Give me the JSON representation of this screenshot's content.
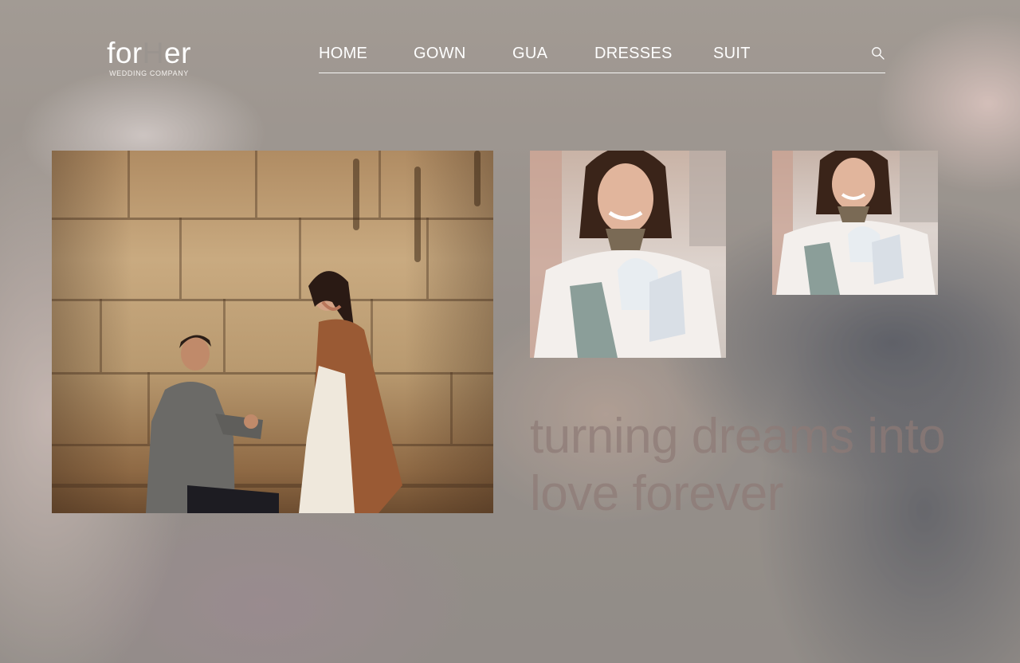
{
  "brand": {
    "logo_prefix": "for",
    "logo_accent": "H",
    "logo_suffix": "er",
    "logo_subtitle": "WEDDING COMPANY"
  },
  "nav": {
    "items": [
      {
        "label": "HOME"
      },
      {
        "label": "GOWN"
      },
      {
        "label": "GUA"
      },
      {
        "label": "DRESSES"
      },
      {
        "label": "SUIT"
      }
    ],
    "search_icon": "search-icon"
  },
  "hero": {
    "tagline_line1": "turning dreams into",
    "tagline_line2": "love forever"
  },
  "colors": {
    "nav_text": "#ffffff",
    "logo_accent": "#9a948f",
    "tagline": "#8e7a76"
  }
}
